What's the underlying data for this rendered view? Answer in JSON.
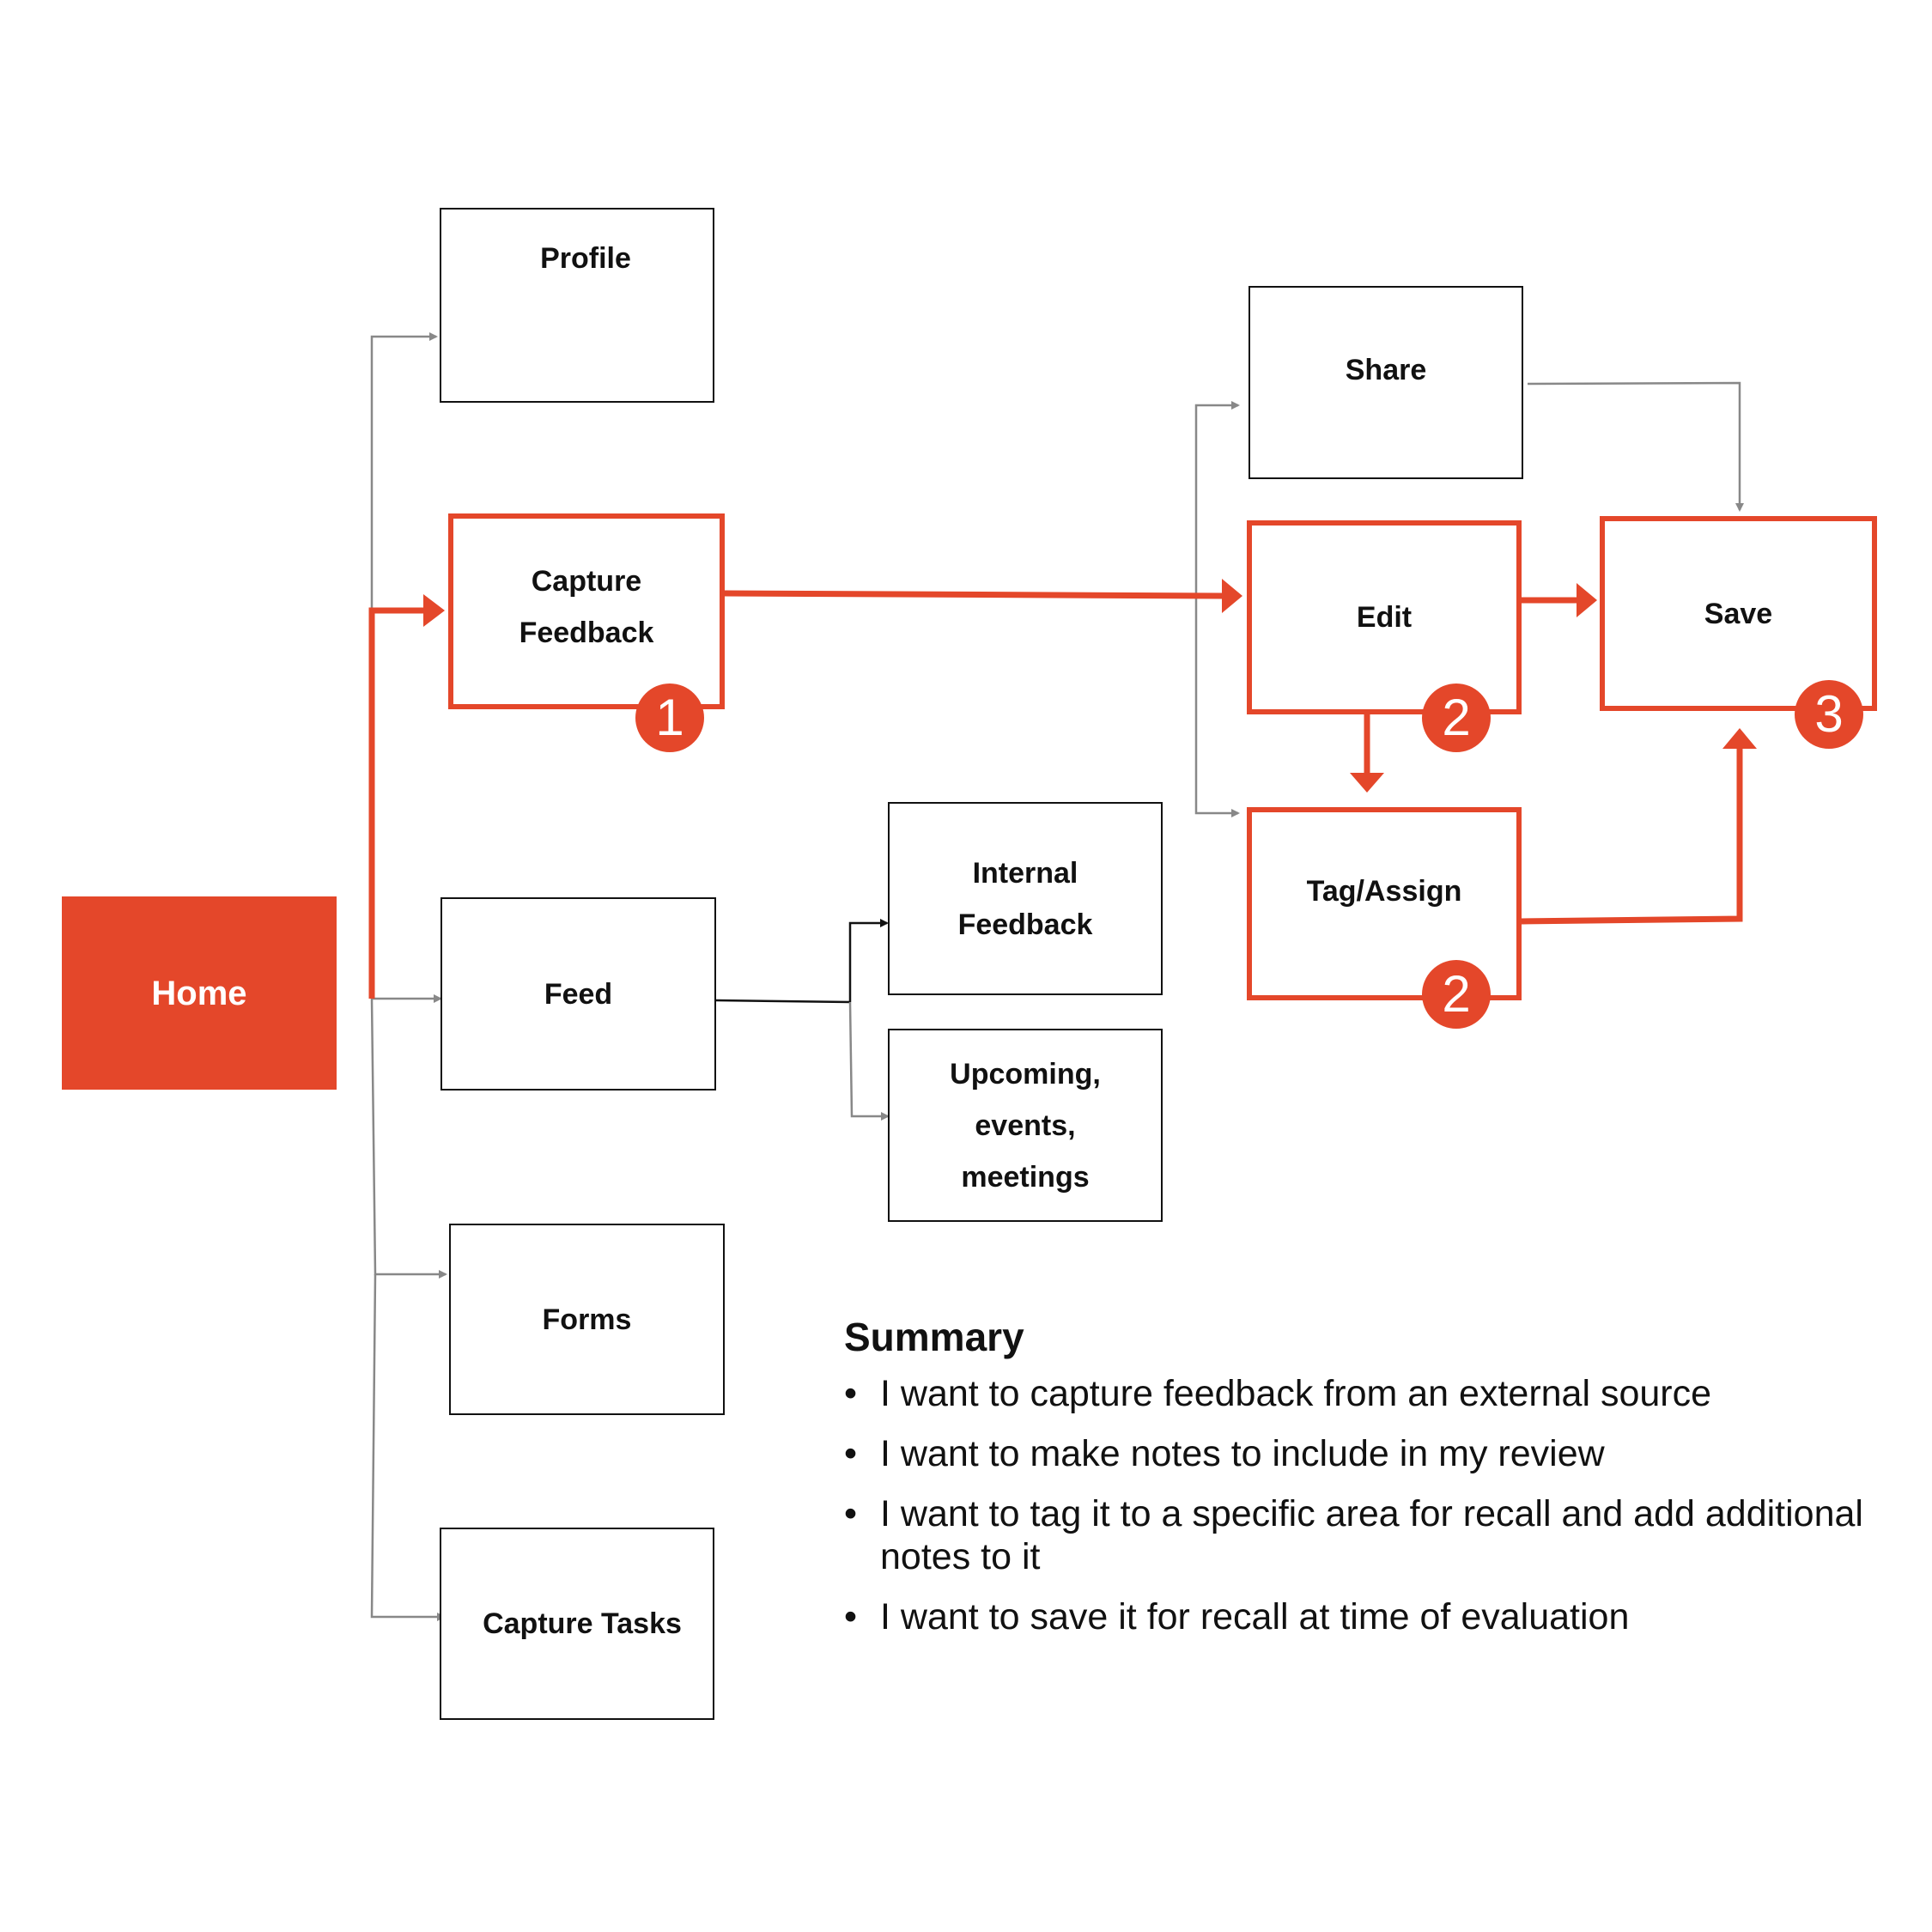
{
  "colors": {
    "accent": "#e4472a",
    "connector": "#888888",
    "border": "#111111"
  },
  "nodes": {
    "home": {
      "label": "Home"
    },
    "profile": {
      "label": "Profile"
    },
    "capture_feedback": {
      "label": "Capture\nFeedback",
      "step": "1"
    },
    "feed": {
      "label": "Feed"
    },
    "forms": {
      "label": "Forms"
    },
    "capture_tasks": {
      "label": "Capture Tasks"
    },
    "internal_feedback": {
      "label": "Internal\nFeedback"
    },
    "upcoming": {
      "label": "Upcoming,\nevents,\nmeetings"
    },
    "share": {
      "label": "Share"
    },
    "edit": {
      "label": "Edit",
      "step": "2"
    },
    "tag_assign": {
      "label": "Tag/Assign",
      "step": "2"
    },
    "save": {
      "label": "Save",
      "step": "3"
    }
  },
  "summary": {
    "title": "Summary",
    "bullet": "•",
    "items": [
      "I want to capture feedback from an external source",
      "I want to make notes to include in my review",
      "I want to tag it to a specific area for recall and add additional notes to it",
      "I want to save it for recall at time of evaluation"
    ]
  }
}
